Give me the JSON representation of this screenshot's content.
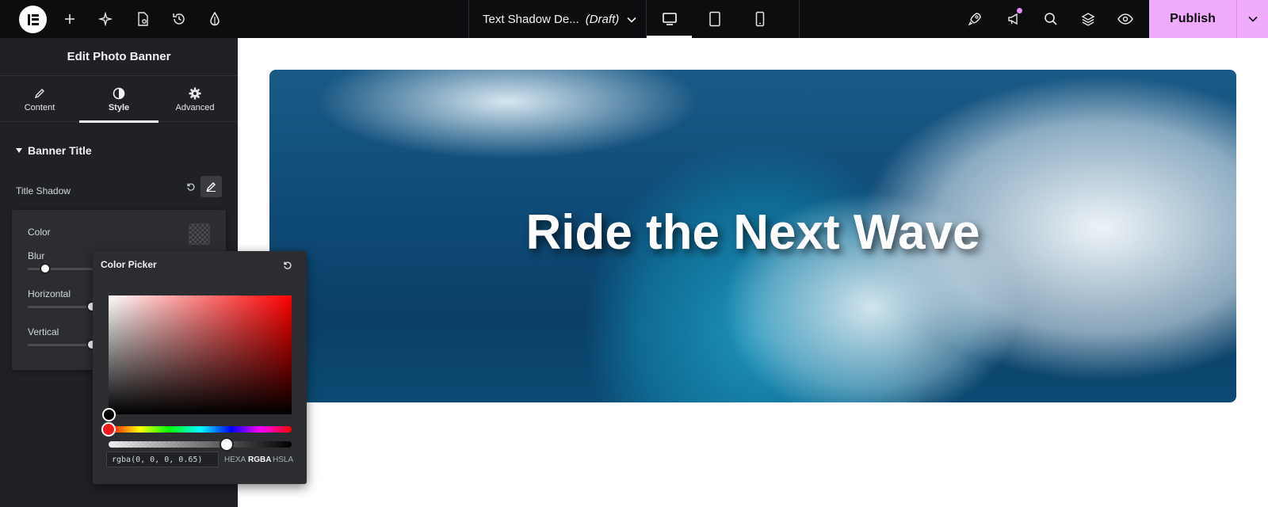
{
  "topbar": {
    "document_title": "Text Shadow De...",
    "document_status": "(Draft)",
    "publish_label": "Publish"
  },
  "panel": {
    "header": "Edit Photo Banner",
    "tabs": [
      {
        "label": "Content",
        "icon": "pencil-icon"
      },
      {
        "label": "Style",
        "icon": "half-circle-icon",
        "active": true
      },
      {
        "label": "Advanced",
        "icon": "gear-icon"
      }
    ],
    "section_title": "Banner Title",
    "control_label": "Title Shadow",
    "popover": {
      "color_label": "Color",
      "blur_label": "Blur",
      "horizontal_label": "Horizontal",
      "vertical_label": "Vertical"
    }
  },
  "color_picker": {
    "title": "Color Picker",
    "value": "rgba(0, 0, 0, 0.65)",
    "formats": [
      "HEXA",
      "RGBA",
      "HSLA"
    ],
    "active_format": "RGBA"
  },
  "canvas": {
    "banner_title": "Ride the Next Wave"
  },
  "colors": {
    "accent": "#f0abfc",
    "panel_bg": "#1f2124",
    "topbar_bg": "#0c0d0e"
  }
}
